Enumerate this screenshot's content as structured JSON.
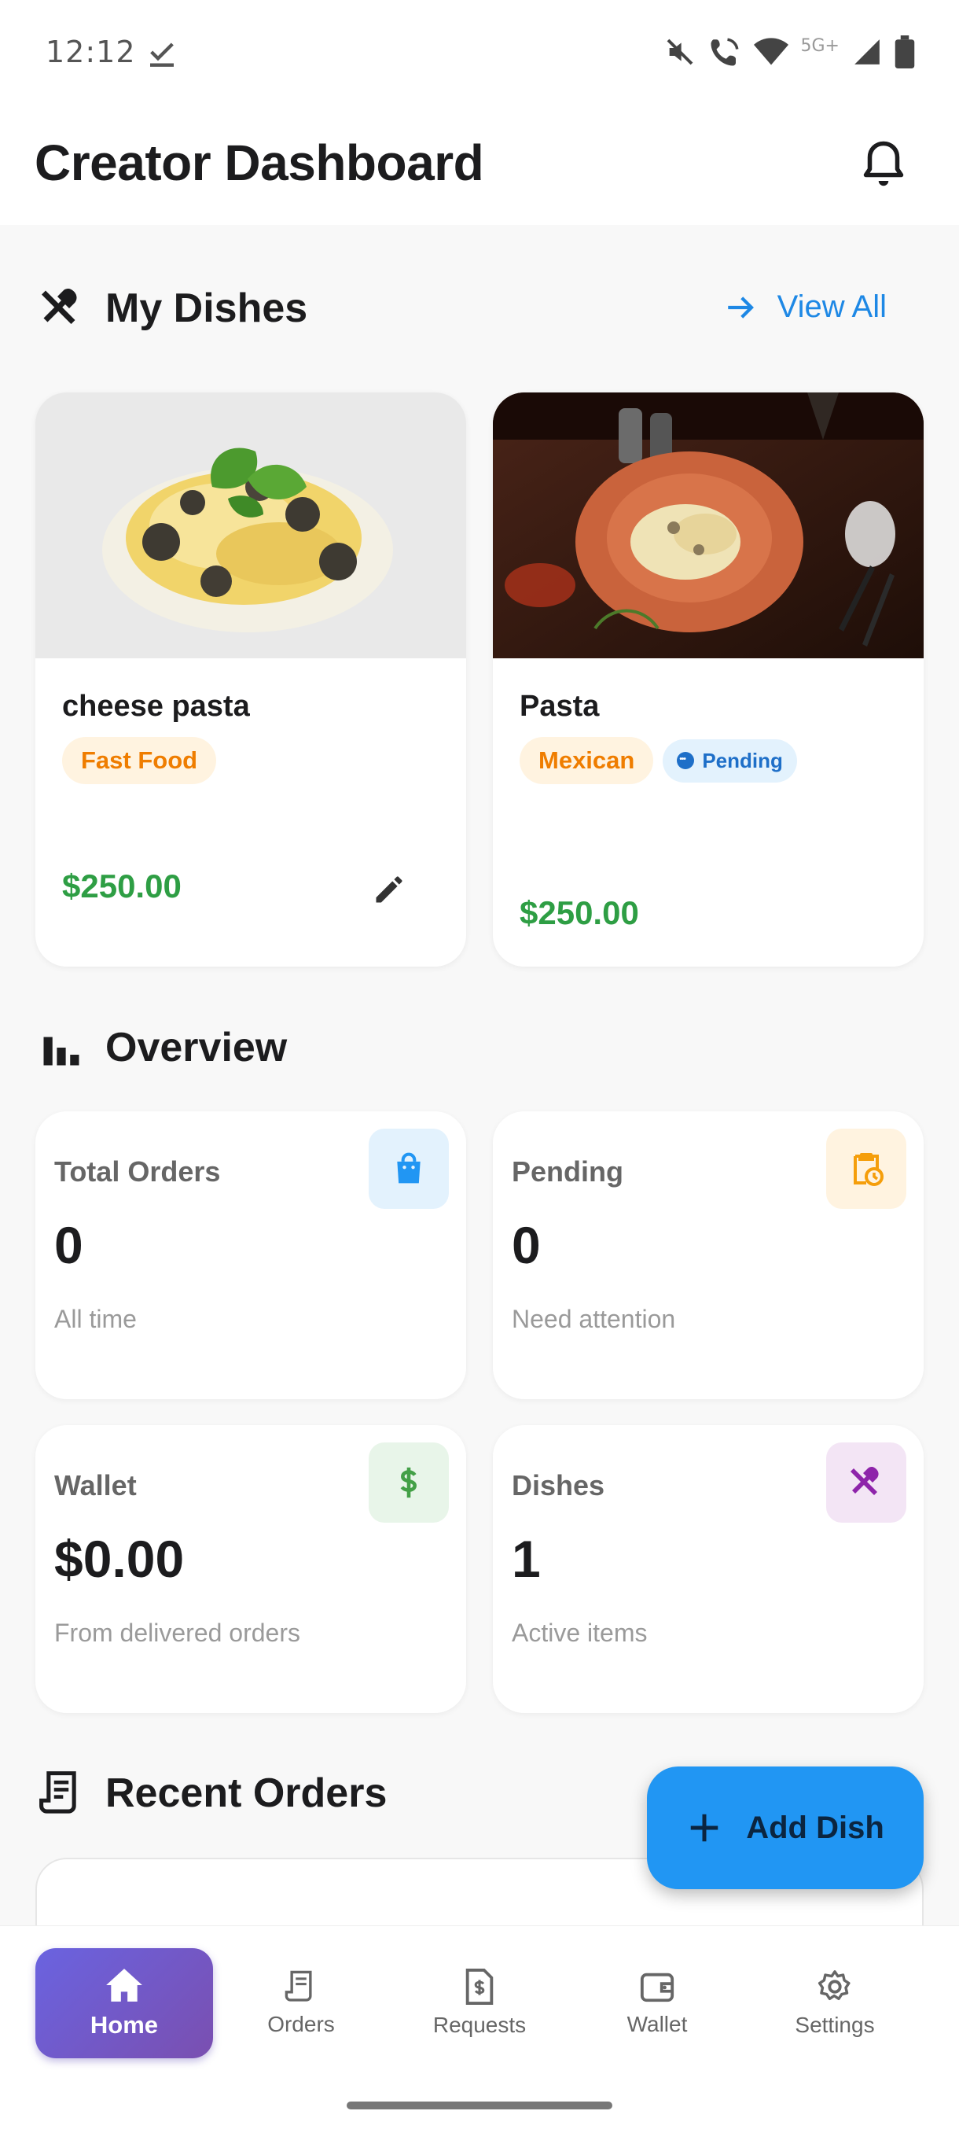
{
  "status_bar": {
    "time": "12:12",
    "network": "5G+"
  },
  "header": {
    "title": "Creator Dashboard"
  },
  "dishes_section": {
    "title": "My Dishes",
    "view_all_label": "View All",
    "dishes": [
      {
        "name": "cheese pasta",
        "category": "Fast Food",
        "price": "$250.00",
        "status": ""
      },
      {
        "name": "Pasta",
        "category": "Mexican",
        "price": "$250.00",
        "status": "Pending"
      }
    ]
  },
  "overview_section": {
    "title": "Overview",
    "cards": [
      {
        "label": "Total Orders",
        "value": "0",
        "sub": "All time",
        "icon": "shopping-bag-icon",
        "color": "#2196f3",
        "bg": "#e3f2fd"
      },
      {
        "label": "Pending",
        "value": "0",
        "sub": "Need attention",
        "icon": "clipboard-clock-icon",
        "color": "#f59e0b",
        "bg": "#fff3e0"
      },
      {
        "label": "Wallet",
        "value": "$0.00",
        "sub": "From delivered orders",
        "icon": "dollar-icon",
        "color": "#43a047",
        "bg": "#e8f5e9"
      },
      {
        "label": "Dishes",
        "value": "1",
        "sub": "Active items",
        "icon": "utensils-icon",
        "color": "#8e24aa",
        "bg": "#f3e5f5"
      }
    ]
  },
  "recent_orders": {
    "title": "Recent Orders"
  },
  "fab": {
    "label": "Add Dish"
  },
  "bottom_nav": {
    "items": [
      {
        "label": "Home",
        "active": true
      },
      {
        "label": "Orders",
        "active": false
      },
      {
        "label": "Requests",
        "active": false
      },
      {
        "label": "Wallet",
        "active": false
      },
      {
        "label": "Settings",
        "active": false
      }
    ]
  },
  "colors": {
    "accent": "#1e88e5",
    "price_green": "#2e9e44",
    "nav_active_start": "#6a63e0",
    "nav_active_end": "#7a4fb0"
  }
}
